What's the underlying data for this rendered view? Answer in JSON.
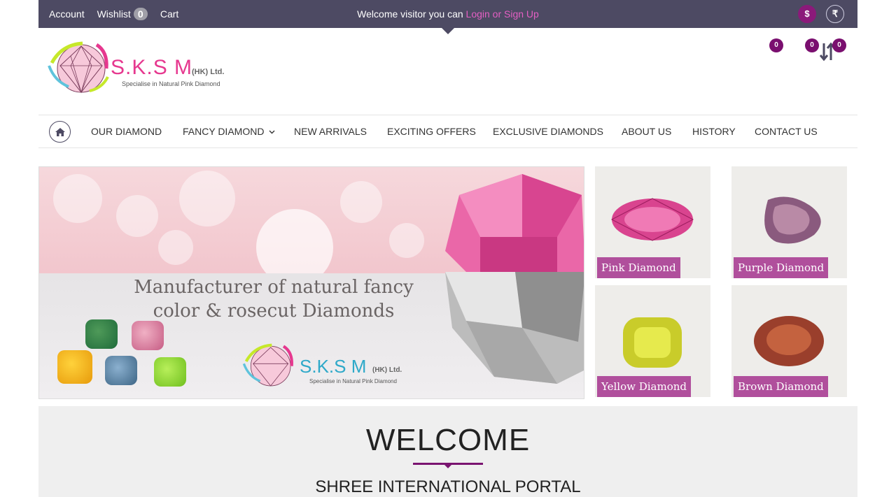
{
  "topbar": {
    "account": "Account",
    "wishlist": "Wishlist",
    "wishlist_count": "0",
    "cart": "Cart",
    "welcome_text": "Welcome visitor you can ",
    "login_link": "Login or Sign Up",
    "currency_usd": "$",
    "currency_inr": "₹",
    "bg_color": "#4d4a63",
    "accent_color": "#e45fc3"
  },
  "header": {
    "logo_text": "S.K.S M",
    "logo_suffix": "(HK) Ltd.",
    "logo_tagline": "Specialise in Natural Pink Diamond",
    "badges": [
      "0",
      "0",
      "0"
    ],
    "sort_icon": "sort-arrows-icon"
  },
  "nav": {
    "home_icon": "home-icon",
    "items": [
      "OUR DIAMOND",
      "FANCY DIAMOND",
      "NEW ARRIVALS",
      "EXCITING OFFERS",
      "EXCLUSIVE DIAMONDS",
      "ABOUT US",
      "HISTORY",
      "CONTACT US"
    ]
  },
  "banner": {
    "headline_line1": "Manufacturer of natural fancy",
    "headline_line2": "color & rosecut Diamonds",
    "logo_text": "S.K.S M",
    "logo_suffix": "(HK) Ltd.",
    "logo_tagline": "Specialise in Natural Pink Diamond"
  },
  "tiles": [
    {
      "label": "Pink Diamond",
      "color": "#d9448f"
    },
    {
      "label": "Purple Diamond",
      "color": "#8a5a7e"
    },
    {
      "label": "Yellow Diamond",
      "color": "#c9cc2a"
    },
    {
      "label": "Brown Diamond",
      "color": "#9a3f2c"
    }
  ],
  "welcome": {
    "title": "WELCOME",
    "subtitle": "SHREE INTERNATIONAL PORTAL",
    "accent_color": "#7a1470"
  }
}
